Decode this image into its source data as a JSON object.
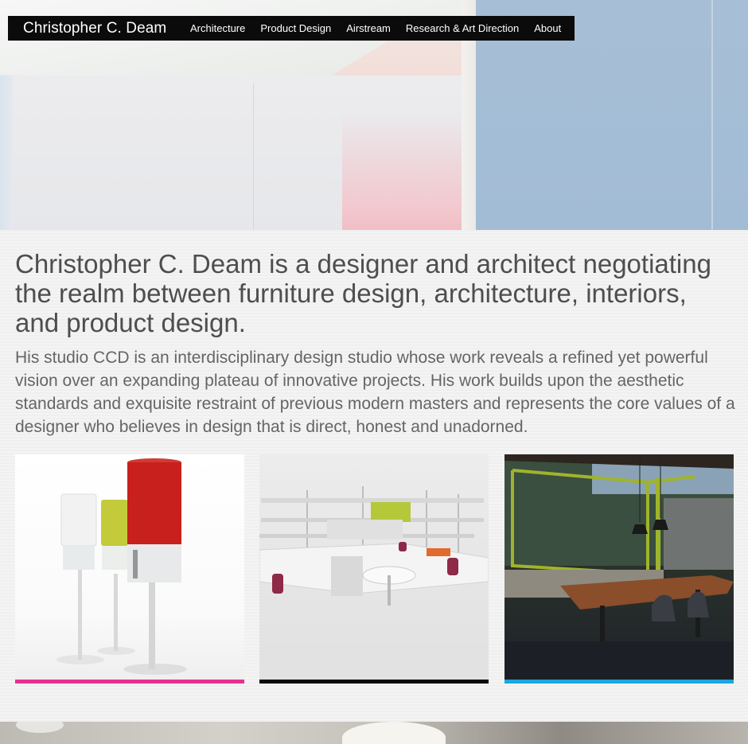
{
  "site": {
    "brand": "Christopher C. Deam"
  },
  "nav": {
    "items": [
      {
        "label": "Architecture"
      },
      {
        "label": "Product Design"
      },
      {
        "label": "Airstream"
      },
      {
        "label": "Research & Art Direction"
      },
      {
        "label": "About"
      }
    ]
  },
  "intro": {
    "headline": "Christopher C. Deam is a designer and architect negotiating the realm between furniture design, architecture, interiors, and product design.",
    "bio": "His studio CCD is an interdisciplinary design studio whose work reveals a refined yet powerful vision over an expanding plateau of innovative projects.  His work builds upon the aesthetic standards and exquisite restraint of previous modern masters and represents the core values of a designer who believes in design that is direct, honest and unadorned."
  },
  "tiles": [
    {
      "accent": "#e8318f"
    },
    {
      "accent": "#0a0a0a"
    },
    {
      "accent": "#1aa6e0"
    }
  ]
}
